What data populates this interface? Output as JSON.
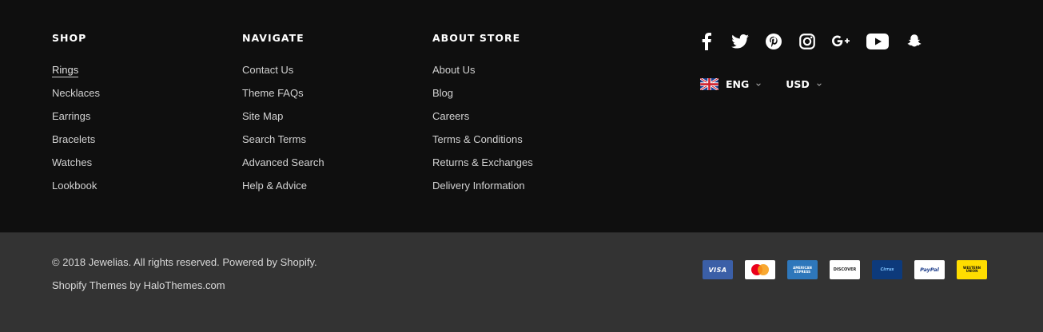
{
  "shop": {
    "title": "SHOP",
    "items": [
      {
        "label": "Rings",
        "active": true
      },
      {
        "label": "Necklaces"
      },
      {
        "label": "Earrings"
      },
      {
        "label": "Bracelets"
      },
      {
        "label": "Watches"
      },
      {
        "label": "Lookbook"
      }
    ]
  },
  "navigate": {
    "title": "NAVIGATE",
    "items": [
      {
        "label": "Contact Us"
      },
      {
        "label": "Theme FAQs"
      },
      {
        "label": "Site Map"
      },
      {
        "label": "Search Terms"
      },
      {
        "label": "Advanced Search"
      },
      {
        "label": "Help & Advice"
      }
    ]
  },
  "about": {
    "title": "ABOUT STORE",
    "items": [
      {
        "label": "About Us"
      },
      {
        "label": "Blog"
      },
      {
        "label": "Careers"
      },
      {
        "label": "Terms & Conditions"
      },
      {
        "label": "Returns & Exchanges"
      },
      {
        "label": "Delivery Information"
      }
    ]
  },
  "social": [
    "facebook-icon",
    "twitter-icon",
    "pinterest-icon",
    "instagram-icon",
    "google-plus-icon",
    "youtube-icon",
    "snapchat-icon"
  ],
  "language": {
    "value": "ENG",
    "flag": "uk-flag-icon"
  },
  "currency": {
    "value": "USD"
  },
  "footer": {
    "copyright": "© 2018 Jewelias. All rights reserved. Powered by Shopify.",
    "credits": "Shopify Themes by HaloThemes.com"
  },
  "payments": {
    "visa": "VISA",
    "amex": "AMERICAN EXPRESS",
    "discover": "DISCOVER",
    "cirrus": "Cirrus",
    "paypal": "PayPal",
    "western_union": "WESTERN UNION"
  },
  "colors": {
    "top_background": "#0f0f0f",
    "bottom_background": "#333333",
    "link_text": "#d2d2d2",
    "heading_text": "#ffffff"
  }
}
